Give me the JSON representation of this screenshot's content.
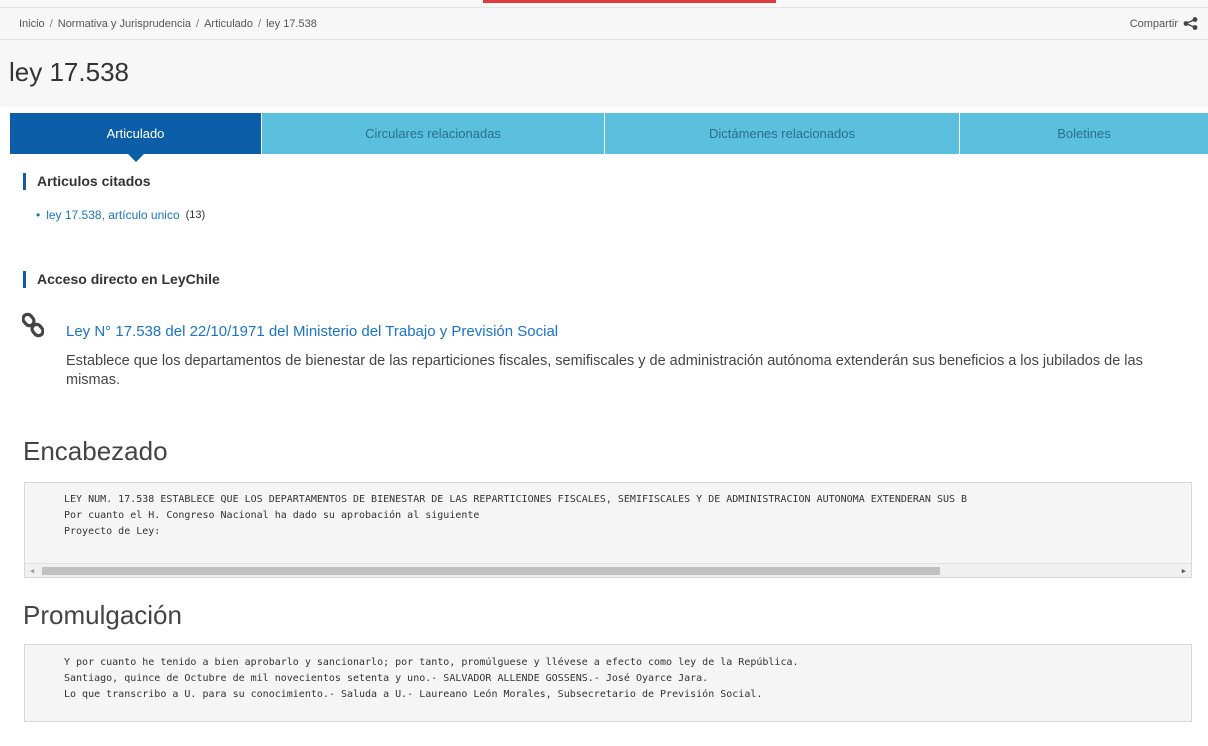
{
  "breadcrumb": {
    "items": [
      "Inicio",
      "Normativa y Jurisprudencia",
      "Articulado",
      "ley 17.538"
    ],
    "separator": "/"
  },
  "share": {
    "label": "Compartir",
    "icon": "share-icon"
  },
  "page": {
    "title": "ley 17.538"
  },
  "tabs": [
    {
      "label": "Articulado",
      "active": true
    },
    {
      "label": "Circulares relacionadas",
      "active": false
    },
    {
      "label": "Dictámenes relacionados",
      "active": false
    },
    {
      "label": "Boletines",
      "active": false
    }
  ],
  "cited": {
    "heading": "Articulos citados",
    "items": [
      {
        "label": "ley 17.538, artículo unico",
        "count": "(13)"
      }
    ]
  },
  "leychile": {
    "heading": "Acceso directo en LeyChile",
    "link_label": "Ley N° 17.538 del 22/10/1971 del Ministerio del Trabajo y Previsión Social",
    "description": "Establece que los departamentos de bienestar de las reparticiones fiscales, semifiscales y de administración autónoma extenderán sus beneficios a los jubilados de las mismas.",
    "icon": "chain-link-icon"
  },
  "encabezado": {
    "heading": "Encabezado",
    "lines": [
      "LEY NUM. 17.538 ESTABLECE QUE LOS DEPARTAMENTOS DE BIENESTAR DE LAS REPARTICIONES FISCALES, SEMIFISCALES Y DE ADMINISTRACION AUTONOMA EXTENDERAN SUS B",
      "Por cuanto el H. Congreso Nacional ha dado su aprobación al siguiente",
      "Proyecto de Ley:"
    ]
  },
  "promulgacion": {
    "heading": "Promulgación",
    "lines": [
      "Y por cuanto he tenido a bien aprobarlo y sancionarlo; por tanto, promúlguese y llévese a efecto como ley de la República.",
      "Santiago, quince de Octubre de mil novecientos setenta y uno.- SALVADOR ALLENDE GOSSENS.- José Oyarce Jara.",
      "Lo que transcribo a U. para su conocimiento.- Saluda a U.- Laureano León Morales, Subsecretario de Previsión Social."
    ]
  },
  "colors": {
    "accent_red": "#e03a3e",
    "tab_active": "#0c5ea8",
    "tab_inactive": "#5bc0de",
    "link": "#1a73c4"
  }
}
